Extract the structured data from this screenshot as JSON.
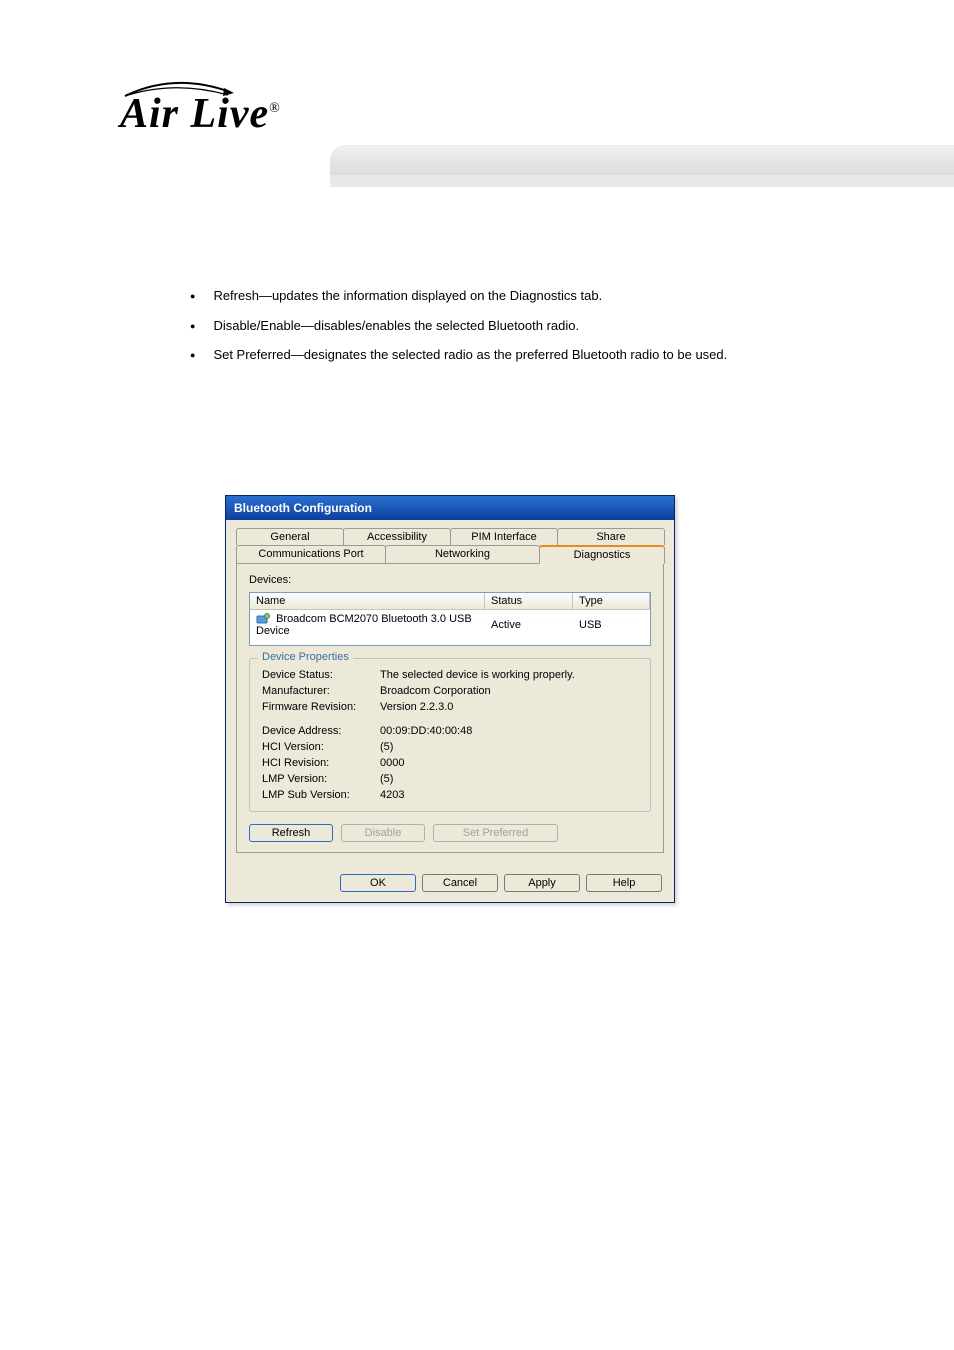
{
  "doc": {
    "bullets": [
      "Refresh—updates the information displayed on the Diagnostics tab.",
      "Disable/Enable—disables/enables the selected Bluetooth radio.",
      "Set Preferred—designates the selected radio as the preferred Bluetooth radio to be used."
    ]
  },
  "dialog": {
    "title": "Bluetooth Configuration",
    "tabs_back": [
      "General",
      "Accessibility",
      "PIM Interface",
      "Share"
    ],
    "tabs_front": [
      "Communications Port",
      "Networking",
      "Diagnostics"
    ],
    "active_tab": "Diagnostics",
    "devices_label": "Devices:",
    "columns": {
      "name": "Name",
      "status": "Status",
      "type": "Type"
    },
    "device": {
      "name": "Broadcom BCM2070 Bluetooth 3.0 USB Device",
      "status": "Active",
      "type": "USB"
    },
    "group_title": "Device Properties",
    "props": {
      "device_status_label": "Device Status:",
      "device_status": "The selected device is working properly.",
      "manufacturer_label": "Manufacturer:",
      "manufacturer": "Broadcom Corporation",
      "firmware_label": "Firmware Revision:",
      "firmware": "Version 2.2.3.0",
      "address_label": "Device Address:",
      "address": "00:09:DD:40:00:48",
      "hci_ver_label": "HCI Version:",
      "hci_ver": "(5)",
      "hci_rev_label": "HCI Revision:",
      "hci_rev": "0000",
      "lmp_ver_label": "LMP Version:",
      "lmp_ver": "(5)",
      "lmp_sub_label": "LMP Sub Version:",
      "lmp_sub": "4203"
    },
    "buttons": {
      "refresh": "Refresh",
      "disable": "Disable",
      "set_preferred": "Set Preferred",
      "ok": "OK",
      "cancel": "Cancel",
      "apply": "Apply",
      "help": "Help"
    }
  }
}
